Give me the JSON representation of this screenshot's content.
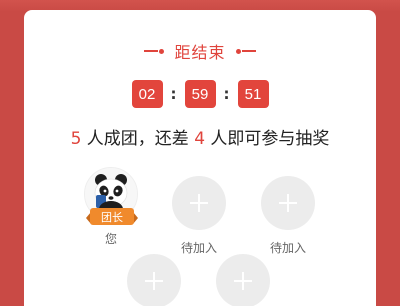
{
  "header": {
    "title": "距结束"
  },
  "timer": {
    "hours": "02",
    "minutes": "59",
    "seconds": "51",
    "separator": ":"
  },
  "status": {
    "members_count": "5",
    "part1": " 人成团，还差 ",
    "remaining_count": "4",
    "part2": " 人即可参与抽奖"
  },
  "members": [
    {
      "label": "您",
      "badge": "团长",
      "icon": "panda-avatar-icon"
    },
    {
      "label": "待加入",
      "icon": "plus-icon"
    },
    {
      "label": "待加入",
      "icon": "plus-icon"
    },
    {
      "label": "",
      "icon": "plus-icon"
    },
    {
      "label": "",
      "icon": "plus-icon"
    }
  ],
  "colors": {
    "background": "#c94a45",
    "accent": "#e0443c",
    "badge": "#f08a2c",
    "empty_slot": "#ececec"
  }
}
